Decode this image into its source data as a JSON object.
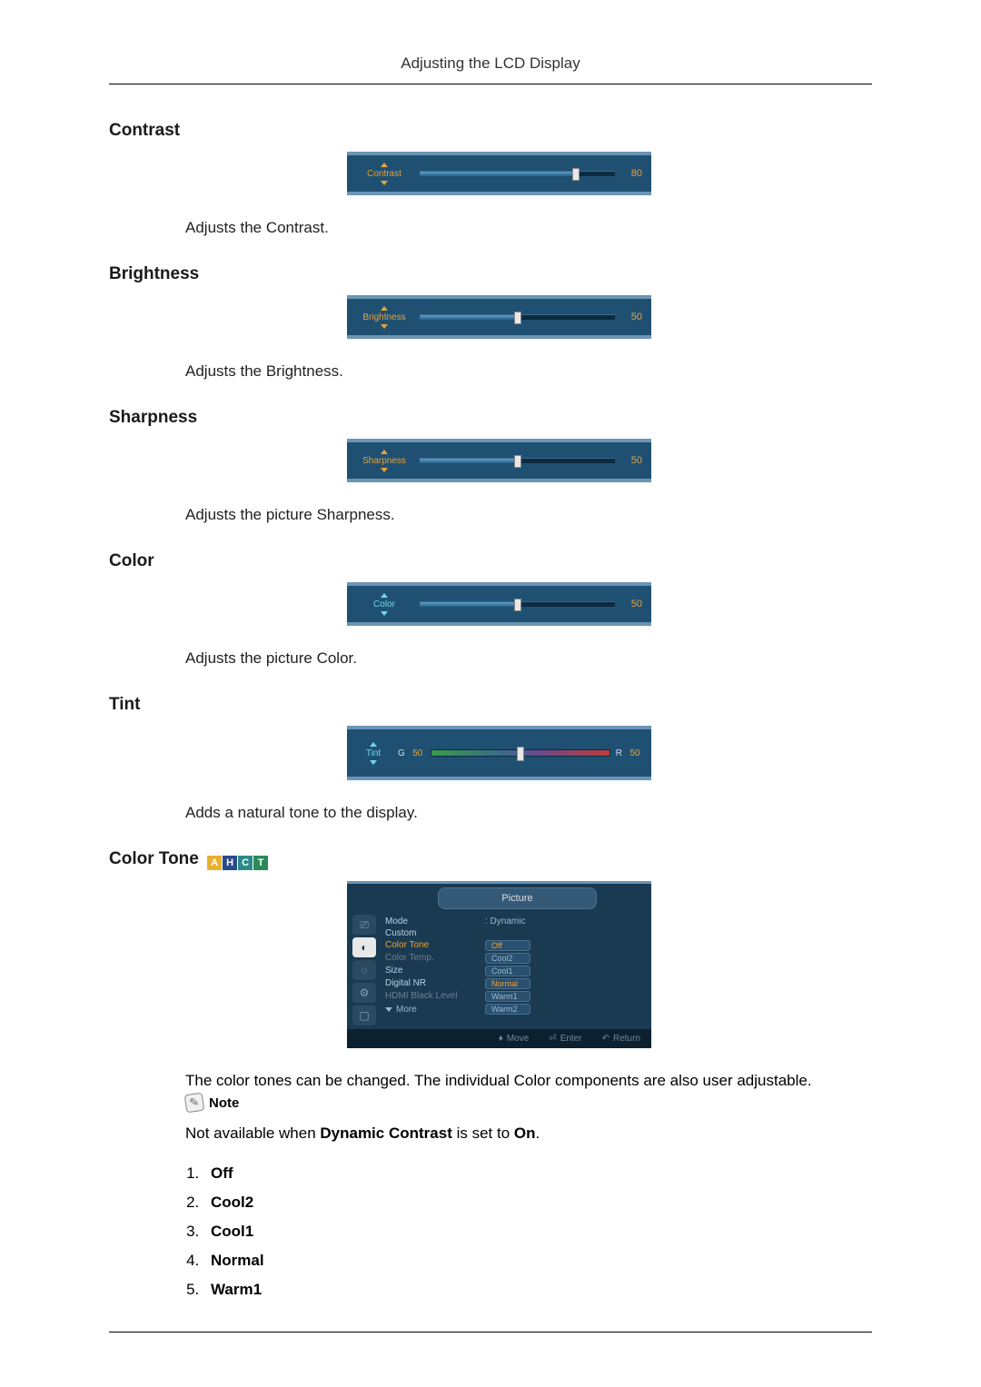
{
  "page_header": "Adjusting the LCD Display",
  "sections": {
    "contrast": {
      "title": "Contrast",
      "slider_label": "Contrast",
      "value": "80",
      "fill_pct": 80,
      "desc": "Adjusts the Contrast."
    },
    "brightness": {
      "title": "Brightness",
      "slider_label": "Brightness",
      "value": "50",
      "fill_pct": 50,
      "desc": "Adjusts the Brightness."
    },
    "sharpness": {
      "title": "Sharpness",
      "slider_label": "Sharpness",
      "value": "50",
      "fill_pct": 50,
      "desc": "Adjusts the picture Sharpness."
    },
    "color": {
      "title": "Color",
      "slider_label": "Color",
      "value": "50",
      "fill_pct": 50,
      "desc": "Adjusts the picture Color."
    },
    "tint": {
      "title": "Tint",
      "slider_label": "Tint",
      "g_label": "G",
      "g_value": "50",
      "r_label": "R",
      "r_value": "50",
      "thumb_pct": 50,
      "desc": "Adds a natural tone to the display."
    },
    "colortone": {
      "title": "Color Tone ",
      "badges": [
        "A",
        "H",
        "C",
        "T"
      ],
      "osd": {
        "title": "Picture",
        "items": [
          {
            "label": "Mode",
            "value": ": Dynamic",
            "hl": false,
            "pill": false
          },
          {
            "label": "Custom",
            "value": "",
            "hl": false,
            "pill": false
          },
          {
            "label": "Color Tone",
            "value": "Off",
            "hl": true,
            "pill": true,
            "pillhl": true
          },
          {
            "label": "Color Temp.",
            "value": "Cool2",
            "hl": false,
            "dim": true,
            "pill": true
          },
          {
            "label": "Size",
            "value": "Cool1",
            "hl": false,
            "pill": true
          },
          {
            "label": "Digital NR",
            "value": "Normal",
            "hl": false,
            "pill": true,
            "pillhl": true
          },
          {
            "label": "HDMI Black Level",
            "value": "Warm1",
            "hl": false,
            "dim": true,
            "pill": true
          },
          {
            "label": "More",
            "value": "Warm2",
            "more": true,
            "pill": true
          }
        ],
        "footer": {
          "move": "Move",
          "enter": "Enter",
          "ret": "Return"
        }
      },
      "para": "The color tones can be changed. The individual Color components are also user adjustable.",
      "note_label": "Note",
      "note_text_pre": "Not available when ",
      "note_text_bold1": "Dynamic Contrast",
      "note_text_mid": " is set to ",
      "note_text_bold2": "On",
      "note_text_post": ".",
      "options": [
        "Off",
        "Cool2",
        "Cool1",
        "Normal",
        "Warm1"
      ]
    }
  }
}
